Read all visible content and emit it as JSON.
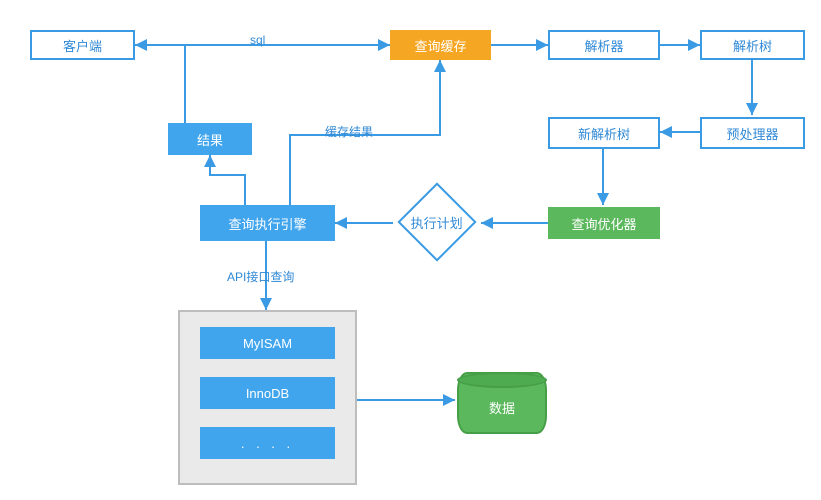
{
  "nodes": {
    "client": "客户端",
    "query_cache": "查询缓存",
    "parser": "解析器",
    "parse_tree": "解析树",
    "preprocessor": "预处理器",
    "new_parse_tree": "新解析树",
    "optimizer": "查询优化器",
    "exec_plan": "执行计划",
    "exec_engine": "查询执行引擎",
    "result": "结果",
    "data": "数据",
    "engines": {
      "myisam": "MyISAM",
      "innodb": "InnoDB",
      "more": ". . . ."
    }
  },
  "edges": {
    "sql": "sql",
    "cache_result": "缓存结果",
    "api_query": "API接口查询"
  },
  "colors": {
    "blue_stroke": "#3a9ae3",
    "blue_fill": "#41a5ee",
    "orange_fill": "#f5a623",
    "green_fill": "#5bb85c",
    "panel_bg": "#eaeaea"
  }
}
